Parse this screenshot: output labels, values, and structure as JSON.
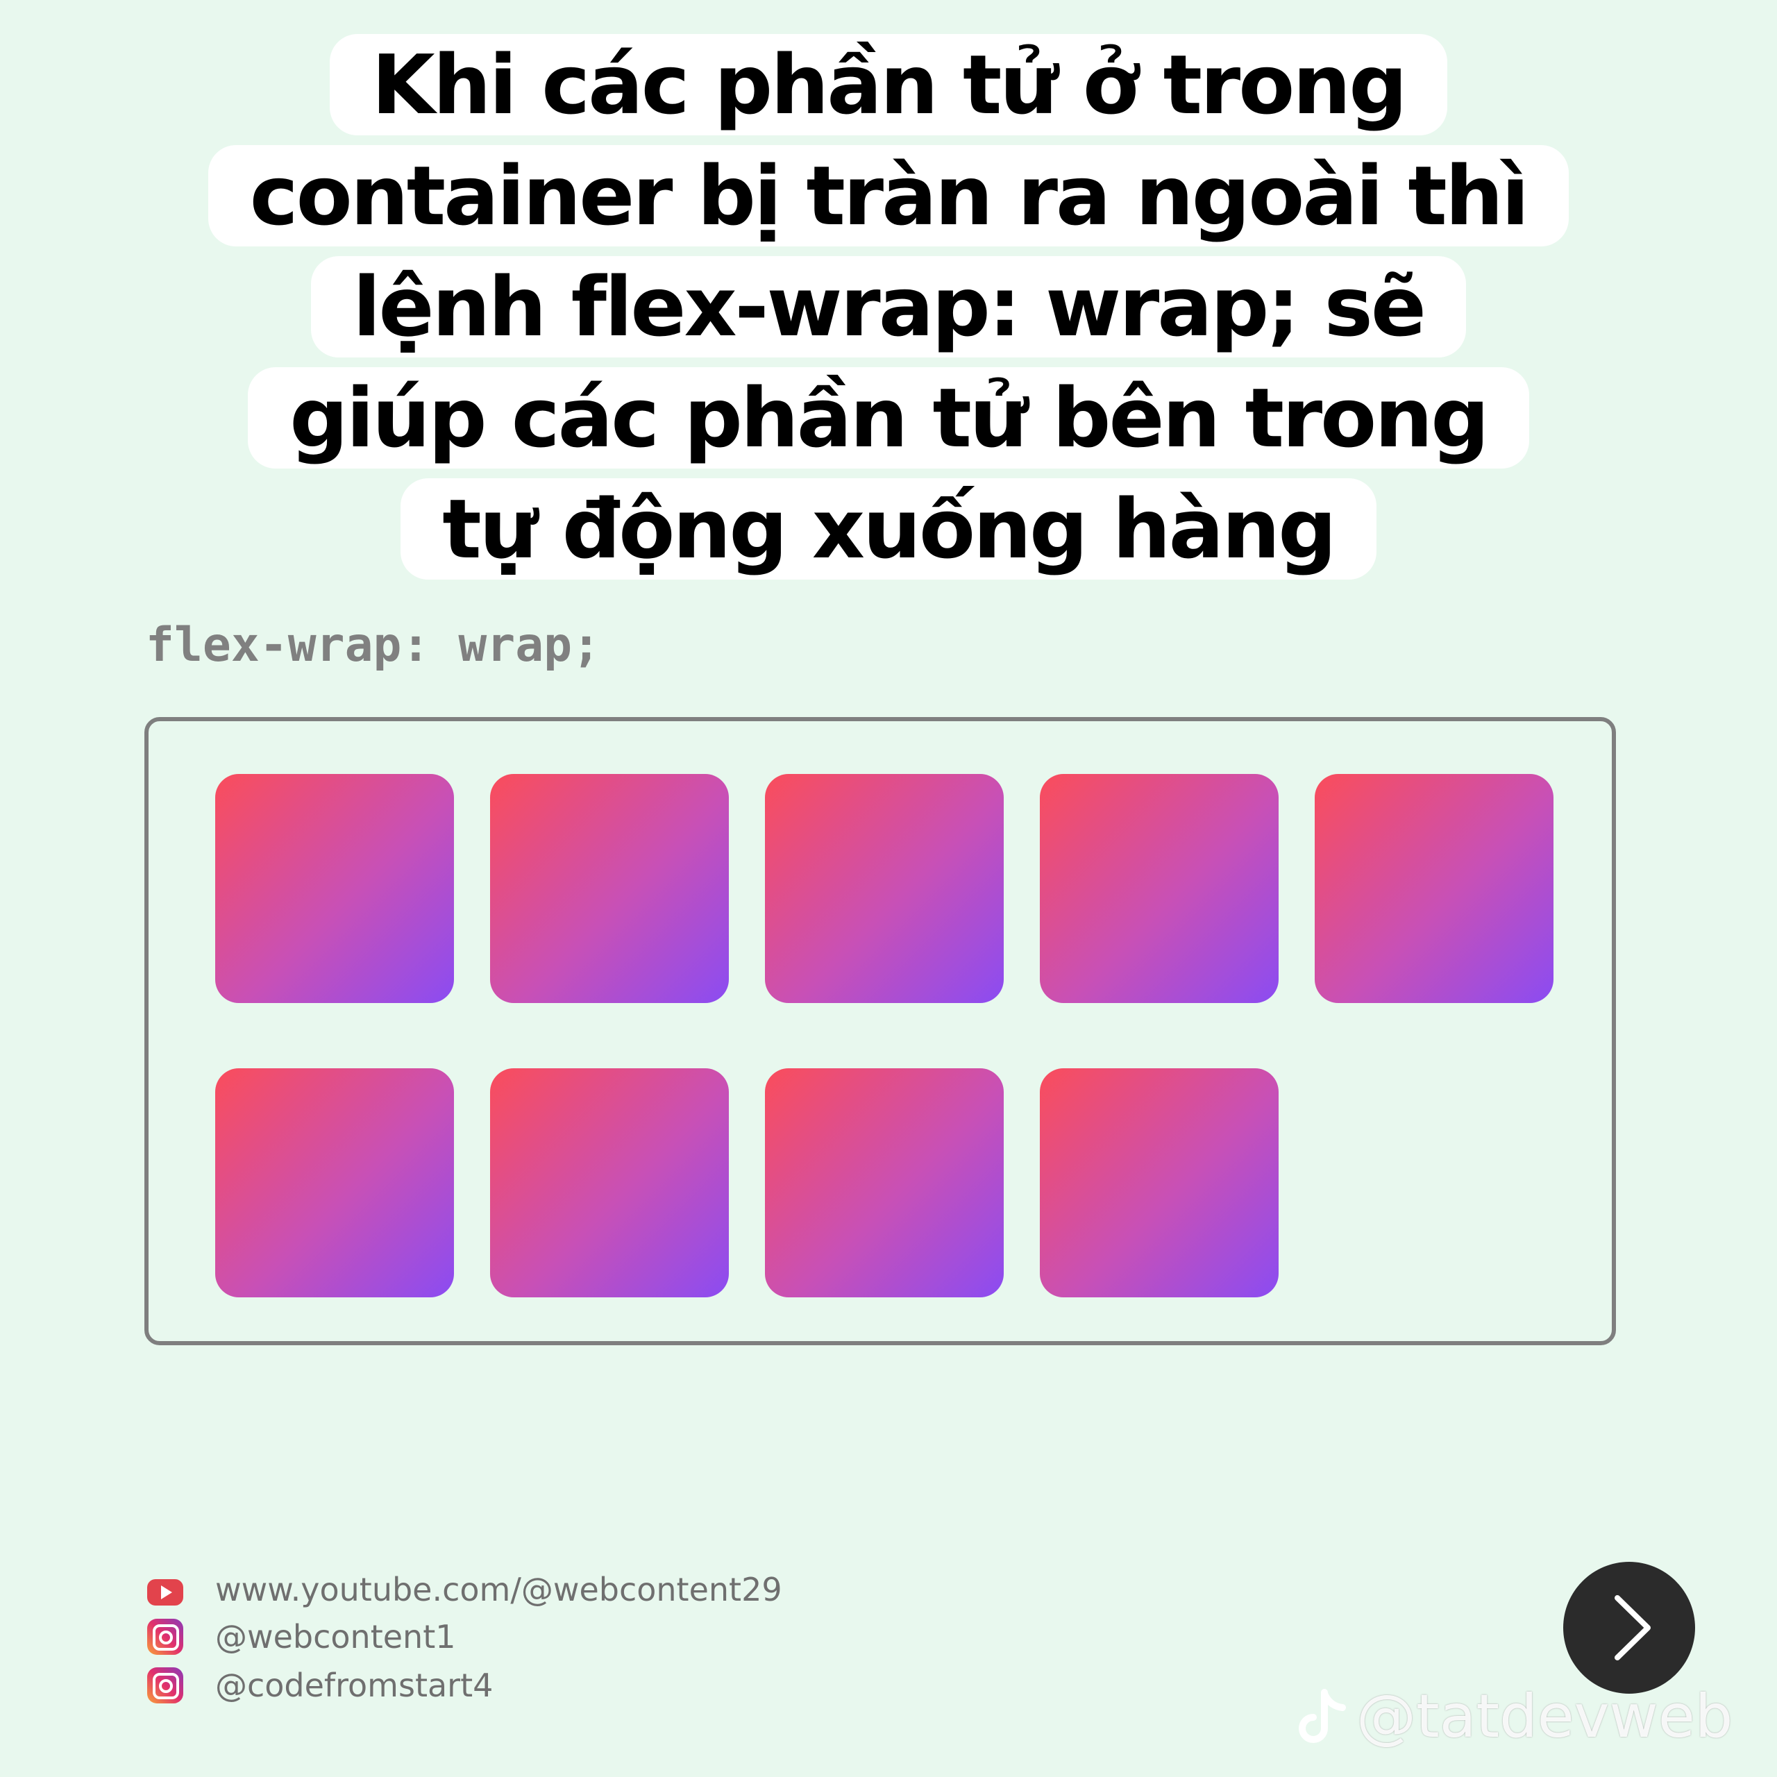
{
  "caption": {
    "lines": [
      "Khi các phần tử ở trong",
      "container bị tràn ra ngoài thì",
      "lệnh flex-wrap: wrap; sẽ",
      "giúp các phần tử bên trong",
      "tự động xuống hàng"
    ]
  },
  "code_label": "flex-wrap: wrap;",
  "demo": {
    "item_count": 9,
    "gradient_colors": [
      "#fa4d5b",
      "#c850b6",
      "#8b4cf2"
    ],
    "border_color": "#7f7f7f"
  },
  "links": [
    {
      "icon": "youtube-icon",
      "text": "www.youtube.com/@webcontent29"
    },
    {
      "icon": "instagram-icon",
      "text": "@webcontent1"
    },
    {
      "icon": "instagram-icon",
      "text": "@codefromstart4"
    }
  ],
  "next_button": {
    "icon": "chevron-right-icon"
  },
  "watermark": {
    "icon": "tiktok-icon",
    "text": "@tatdevweb"
  },
  "colors": {
    "background": "#e8f8ee",
    "button": "#2b2b2b"
  }
}
